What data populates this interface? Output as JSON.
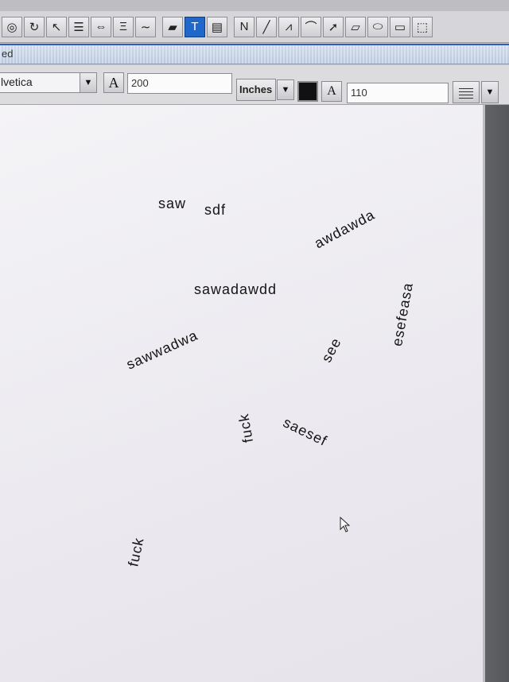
{
  "window": {
    "title": "ed"
  },
  "toolbar": {
    "tools": [
      {
        "name": "lasso-icon",
        "glyph": "◎"
      },
      {
        "name": "rotate-icon",
        "glyph": "↻"
      },
      {
        "name": "pointer-tool-icon",
        "glyph": "↖"
      },
      {
        "name": "stack-icon",
        "glyph": "☰"
      },
      {
        "name": "distribute-icon",
        "glyph": "⇔"
      },
      {
        "name": "align-icon",
        "glyph": "Ξ"
      },
      {
        "name": "freehand-icon",
        "glyph": "∼"
      },
      {
        "name": "folder-icon",
        "glyph": "▰"
      },
      {
        "name": "text-tool-icon",
        "glyph": "T",
        "active": true
      },
      {
        "name": "textbox-tool-icon",
        "glyph": "▤"
      },
      {
        "name": "north-arrow-icon",
        "glyph": "N"
      },
      {
        "name": "line-tool-icon",
        "glyph": "╱"
      },
      {
        "name": "polyline-tool-icon",
        "glyph": "⩘"
      },
      {
        "name": "curve-tool-icon",
        "glyph": "⌒"
      },
      {
        "name": "arrow-tool-icon",
        "glyph": "➚"
      },
      {
        "name": "parallelogram-tool-icon",
        "glyph": "▱"
      },
      {
        "name": "ellipse-tool-icon",
        "glyph": "⬭"
      },
      {
        "name": "rectangle-tool-icon",
        "glyph": "▭"
      },
      {
        "name": "dotted-rect-tool-icon",
        "glyph": "⬚"
      }
    ]
  },
  "format": {
    "font": "lvetica",
    "font_size_glyph": "A",
    "font_size": "200",
    "units": "Inches",
    "color": "#111111",
    "char_spacing_glyph": "A",
    "char_spacing": "110"
  },
  "canvas": {
    "words": [
      {
        "text": "saw",
        "rot": 0
      },
      {
        "text": "sdf",
        "rot": 0
      },
      {
        "text": "awdawda",
        "rot": -28
      },
      {
        "text": "sawadawdd",
        "rot": 0
      },
      {
        "text": "esefeasa",
        "rot": -80
      },
      {
        "text": "sawwadwa",
        "rot": -24
      },
      {
        "text": "see",
        "rot": -62
      },
      {
        "text": "fuck",
        "rot": -100
      },
      {
        "text": "saesef",
        "rot": 26
      },
      {
        "text": "fuck",
        "rot": -78
      }
    ]
  }
}
